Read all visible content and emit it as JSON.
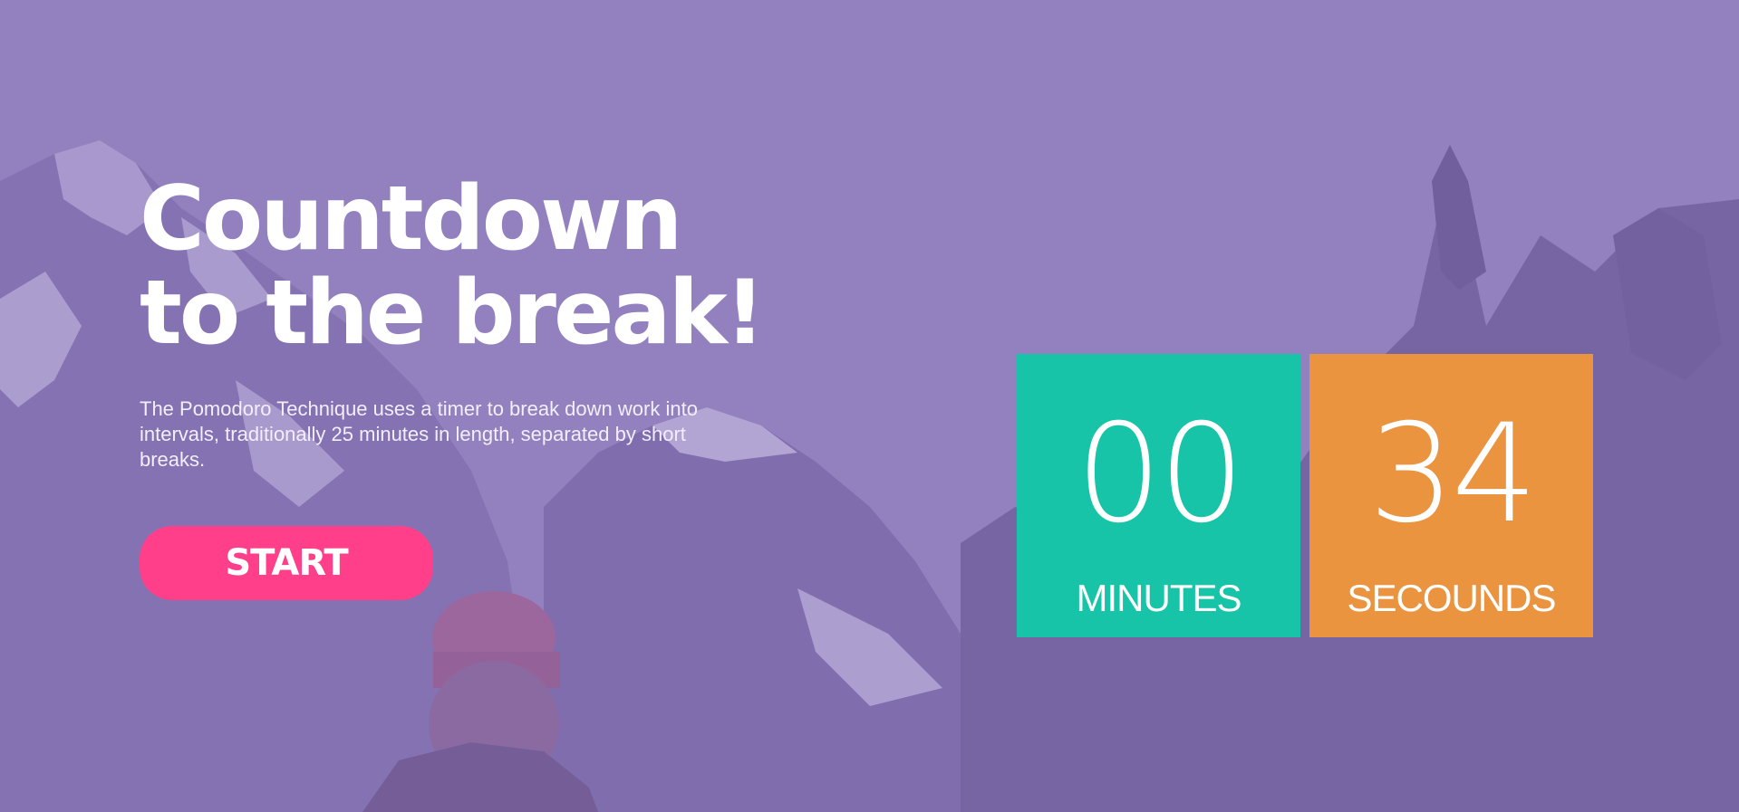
{
  "hero": {
    "headline_line1": "Countdown",
    "headline_line2": "to the break!",
    "description": "The Pomodoro Technique uses a timer to break down work into intervals, traditionally 25 minutes in length, separated by short breaks.",
    "start_label": "START"
  },
  "timer": {
    "minutes_value": "00",
    "minutes_label": "MINUTES",
    "seconds_value": "34",
    "seconds_label": "SECOUNDS"
  },
  "colors": {
    "overlay": "#8f7fb7",
    "start_button": "#ff3f8a",
    "minutes_tile": "#17c4a8",
    "seconds_tile": "#ea9440",
    "text": "#ffffff"
  },
  "background": {
    "image_subject": "mountain-hiker-photo"
  }
}
